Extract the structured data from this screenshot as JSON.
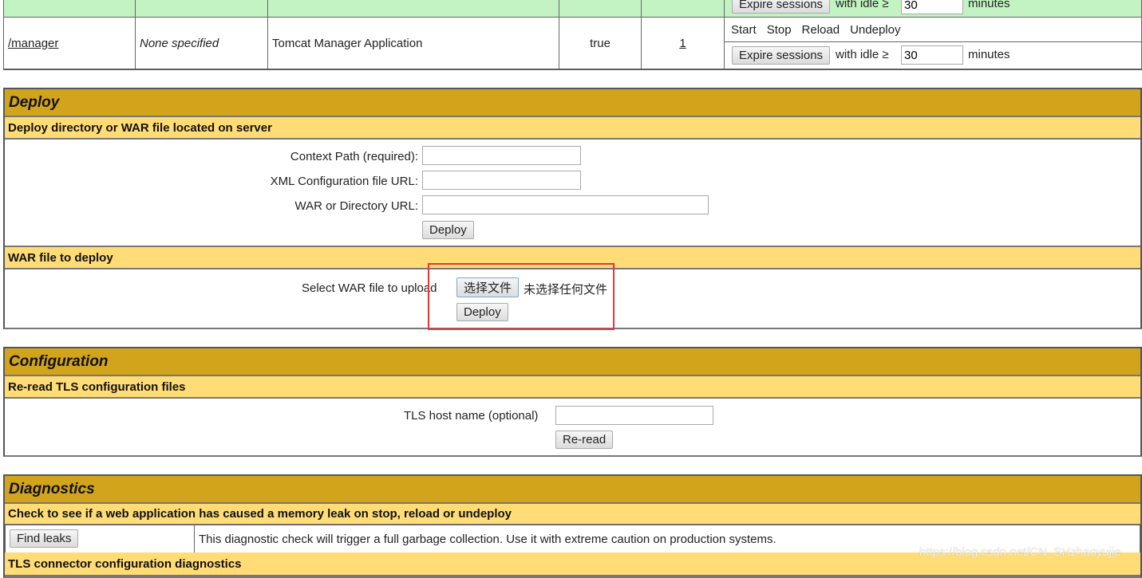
{
  "apps": {
    "top_row": {
      "expire_label": "Expire sessions",
      "idle_label": "with idle ≥",
      "idle_value": "30",
      "minutes": "minutes"
    },
    "manager_row": {
      "path": "/manager",
      "version": "None specified",
      "display_name": "Tomcat Manager Application",
      "running": "true",
      "sessions": "1",
      "commands": [
        "Start",
        "Stop",
        "Reload",
        "Undeploy"
      ],
      "expire_label": "Expire sessions",
      "idle_label": "with idle ≥",
      "idle_value": "30",
      "minutes": "minutes"
    }
  },
  "deploy": {
    "title": "Deploy",
    "server_sub": "Deploy directory or WAR file located on server",
    "context_label": "Context Path (required):",
    "xml_label": "XML Configuration file URL:",
    "war_url_label": "WAR or Directory URL:",
    "deploy_button": "Deploy",
    "war_sub": "WAR file to deploy",
    "select_label": "Select WAR file to upload",
    "choose_file": "选择文件",
    "no_file": "未选择任何文件",
    "upload_deploy_button": "Deploy"
  },
  "config": {
    "title": "Configuration",
    "sub": "Re-read TLS configuration files",
    "tls_label": "TLS host name (optional)",
    "reread_button": "Re-read"
  },
  "diagnostics": {
    "title": "Diagnostics",
    "sub": "Check to see if a web application has caused a memory leak on stop, reload or undeploy",
    "find_leaks": "Find leaks",
    "leak_desc": "This diagnostic check will trigger a full garbage collection. Use it with extreme caution on production systems.",
    "tls_sub": "TLS connector configuration diagnostics"
  },
  "watermark": "https://blog.csdn.net/CN_SHzhaoyujie",
  "colors": {
    "section_title": "#D2A41C",
    "subheader": "#FFDC75",
    "row_green": "#C3F3C3",
    "highlight": "#E8353A"
  }
}
